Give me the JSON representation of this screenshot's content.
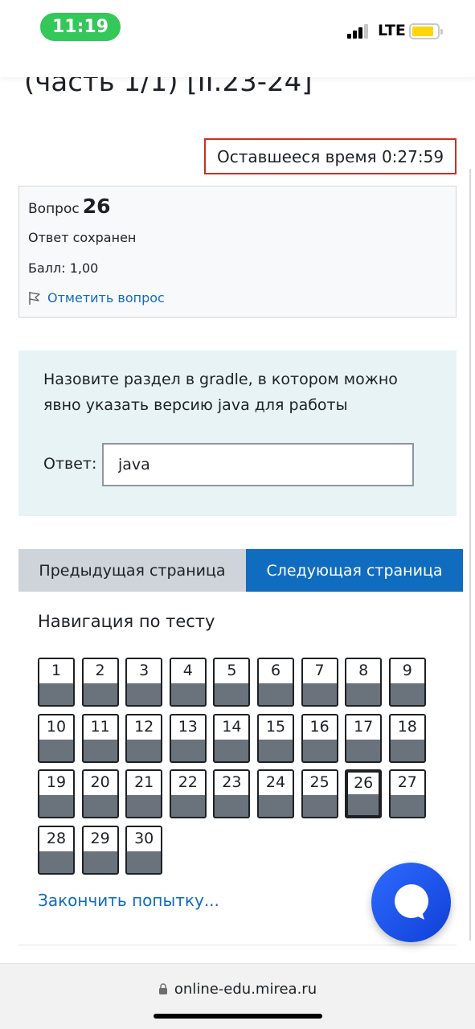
{
  "status_bar": {
    "time": "11:19",
    "network": "LTE"
  },
  "page": {
    "title": "(часть 1/1) [II.23-24]"
  },
  "timer": {
    "text": "Оставшееся время 0:27:59"
  },
  "question_info": {
    "label": "Вопрос",
    "number": "26",
    "state": "Ответ сохранен",
    "grade": "Балл: 1,00",
    "flag_label": "Отметить вопрос"
  },
  "question": {
    "text": "Назовите раздел в gradle, в котором можно явно указать версию java для работы",
    "answer_label": "Ответ:",
    "answer_value": "java"
  },
  "nav_buttons": {
    "prev": "Предыдущая страница",
    "next": "Следующая страница"
  },
  "quiz_nav": {
    "title": "Навигация по тесту",
    "current": 26,
    "questions": [
      "1",
      "2",
      "3",
      "4",
      "5",
      "6",
      "7",
      "8",
      "9",
      "10",
      "11",
      "12",
      "13",
      "14",
      "15",
      "16",
      "17",
      "18",
      "19",
      "20",
      "21",
      "22",
      "23",
      "24",
      "25",
      "26",
      "27",
      "28",
      "29",
      "30"
    ],
    "finish_label": "Закончить попытку..."
  },
  "browser": {
    "url": "online-edu.mirea.ru"
  },
  "colors": {
    "accent": "#0f6cbf",
    "timer_border": "#ca3120",
    "answered_fill": "#6a737b",
    "clock_pill": "#34c759"
  }
}
